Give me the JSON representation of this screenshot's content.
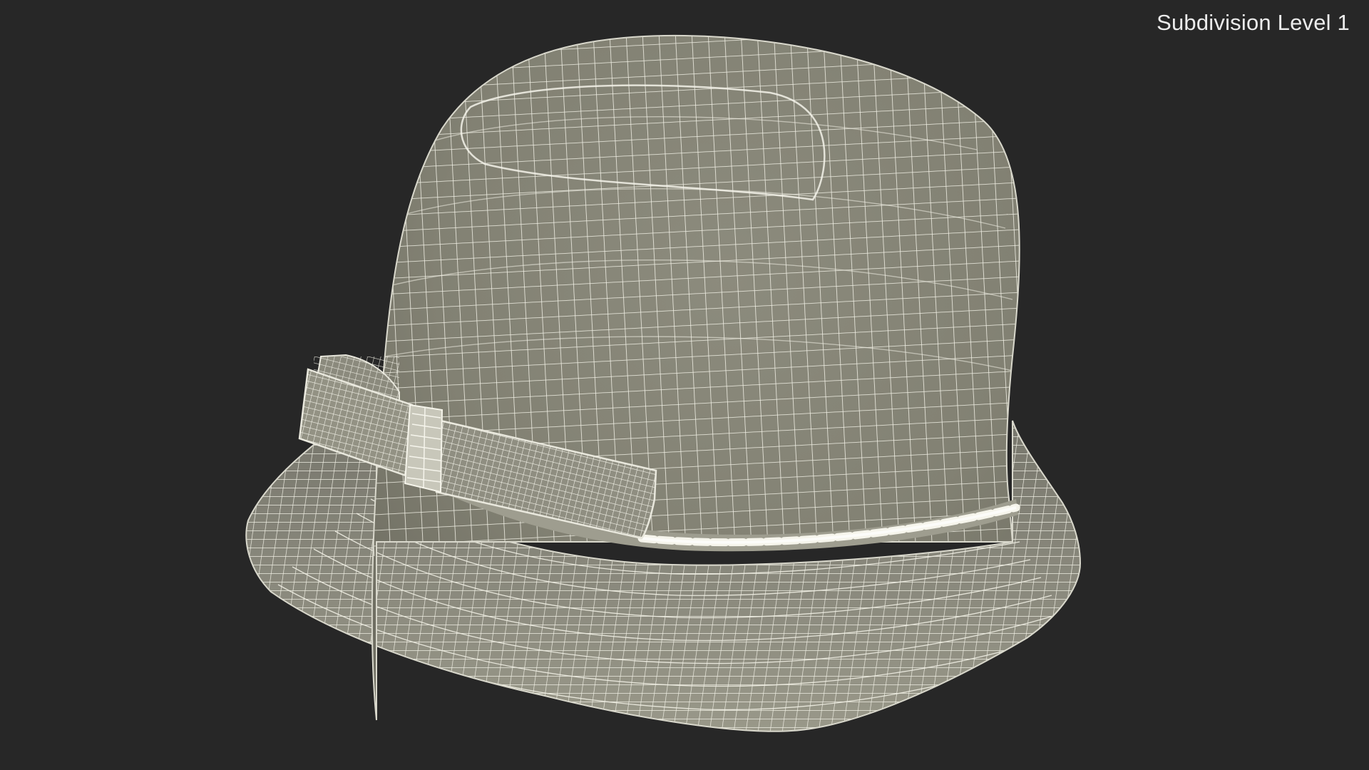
{
  "viewport": {
    "label": "Subdivision Level 1",
    "background": "#272727"
  },
  "model": {
    "subject": "cloche-hat-with-bow",
    "display_mode": "wireframe-on-shaded",
    "surface_color": "#838274",
    "wire_color": "#eeeee2"
  }
}
